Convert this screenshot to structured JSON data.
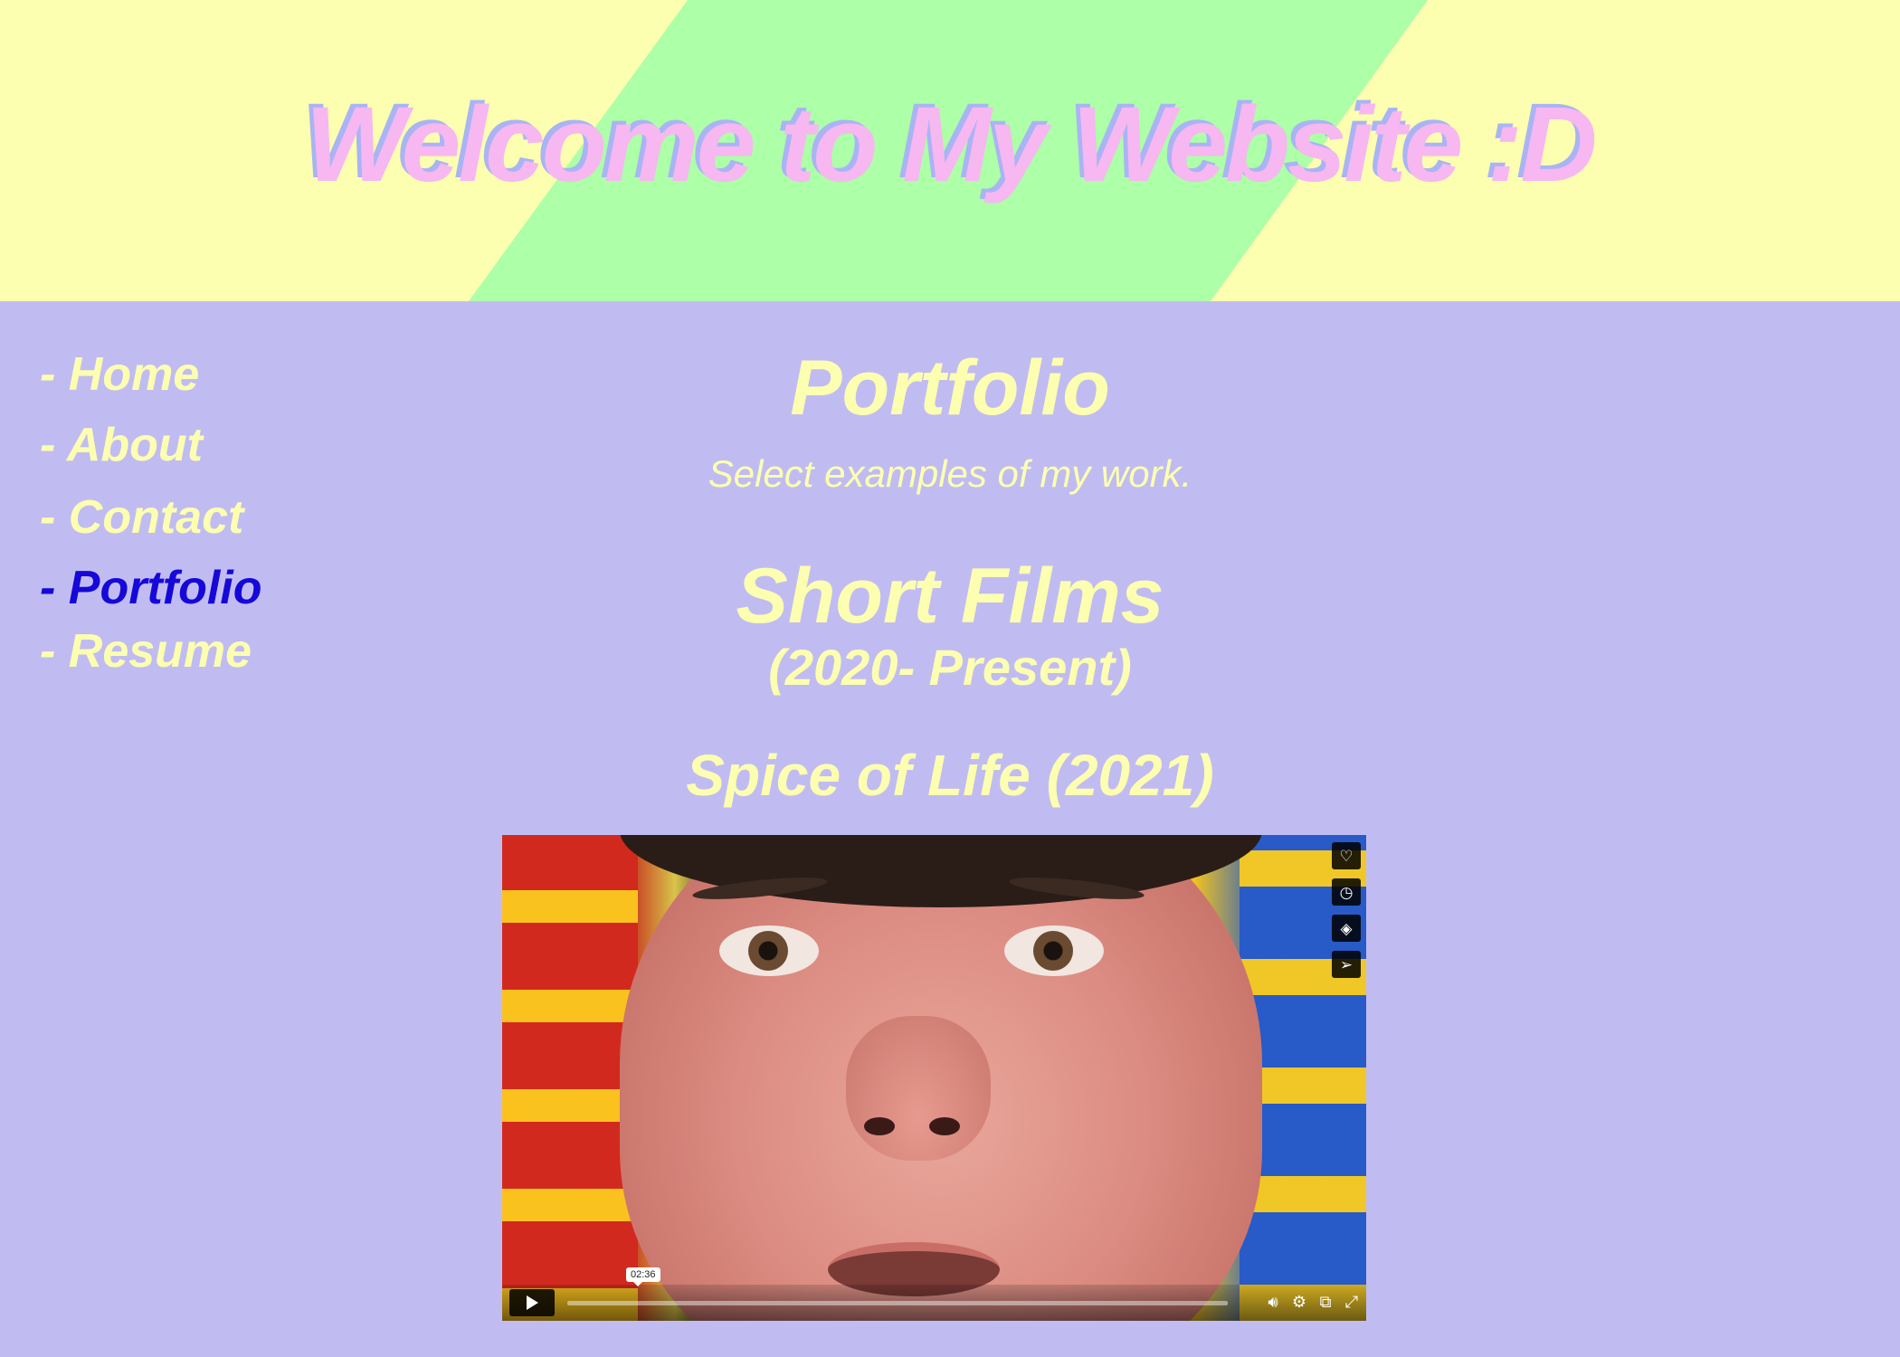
{
  "header": {
    "title": "Welcome to My Website :D"
  },
  "nav": {
    "items": [
      {
        "label": "- Home",
        "active": false
      },
      {
        "label": "- About",
        "active": false
      },
      {
        "label": "- Contact",
        "active": false
      },
      {
        "label": "- Portfolio",
        "active": true
      },
      {
        "label": "- Resume",
        "active": false
      }
    ]
  },
  "main": {
    "title": "Portfolio",
    "subtitle": "Select examples of my work.",
    "section_title": "Short Films",
    "section_range": "(2020- Present)",
    "film_title": "Spice of Life (2021)"
  },
  "video": {
    "hover_time": "02:36",
    "side_icons": [
      "heart-icon",
      "clock-icon",
      "layers-icon",
      "send-icon"
    ],
    "control_icons": [
      "volume-icon",
      "settings-icon",
      "pip-icon",
      "fullscreen-icon"
    ]
  },
  "colors": {
    "background": "#c0bcf2",
    "banner_yellow": "#fdffb0",
    "banner_green": "#adffa8",
    "title_pink": "#f7b7f0",
    "text_yellow": "#fdffb0",
    "active_link": "#1608d8"
  }
}
